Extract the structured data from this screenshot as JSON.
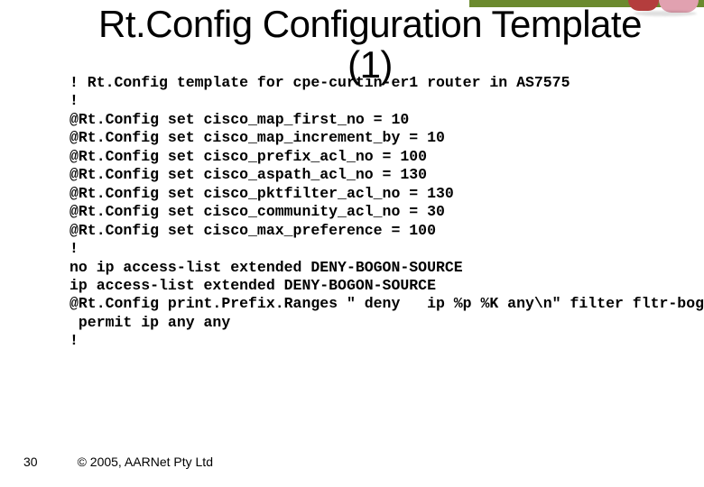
{
  "title_line1": "Rt.Config Configuration Template",
  "title_line2": "(1)",
  "code_lines": [
    "! Rt.Config template for cpe-curtin-er1 router in AS7575",
    "!",
    "@Rt.Config set cisco_map_first_no = 10",
    "@Rt.Config set cisco_map_increment_by = 10",
    "@Rt.Config set cisco_prefix_acl_no = 100",
    "@Rt.Config set cisco_aspath_acl_no = 130",
    "@Rt.Config set cisco_pktfilter_acl_no = 130",
    "@Rt.Config set cisco_community_acl_no = 30",
    "@Rt.Config set cisco_max_preference = 100",
    "!",
    "no ip access-list extended DENY-BOGON-SOURCE",
    "ip access-list extended DENY-BOGON-SOURCE",
    "@Rt.Config print.Prefix.Ranges \" deny   ip %p %K any\\n\" filter fltr-bogons",
    " permit ip any any",
    "!"
  ],
  "page_number": "30",
  "copyright": "© 2005, AARNet Pty Ltd"
}
